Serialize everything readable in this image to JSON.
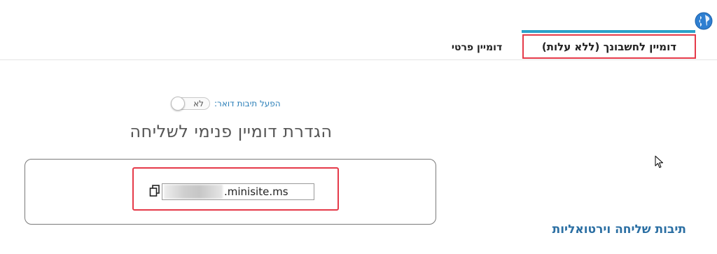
{
  "tabs": {
    "active_label": "דומיין לחשבונך (ללא עלות)",
    "other_label": "דומיין פרטי"
  },
  "mail": {
    "label": "הפעל תיבות דואר:",
    "toggle_text": "לא"
  },
  "section": {
    "title": "הגדרת דומיין פנימי לשליחה"
  },
  "domain": {
    "suffix": ".minisite.ms"
  },
  "sidebar": {
    "virtual_mailboxes_label": "תיבות שליחה וירטואליות"
  },
  "colors": {
    "accent": "#2aa1c9",
    "highlight": "#e53a49",
    "link": "#2b6fa3"
  },
  "icons": {
    "globe": "globe-icon",
    "copy": "copy-icon",
    "cursor": "mouse-cursor-icon"
  }
}
